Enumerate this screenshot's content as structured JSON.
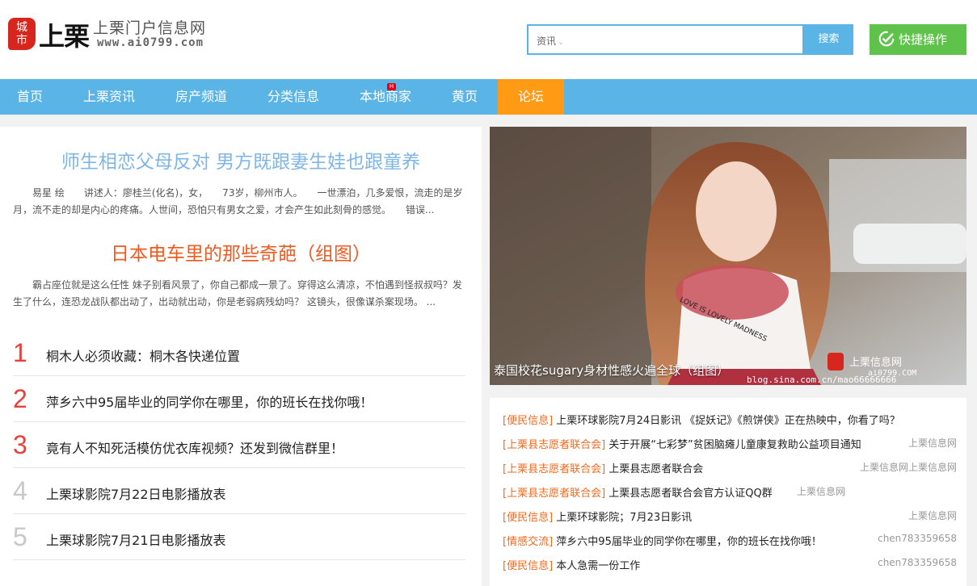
{
  "logo": {
    "badge": "城\n市",
    "main": "上栗",
    "site_name": "上栗门户信息网",
    "url": "www.ai0799.com"
  },
  "search": {
    "type": "资讯",
    "placeholder": "",
    "button": "搜索"
  },
  "quick_action": {
    "label": "快捷操作",
    "icon": "edit-check-icon"
  },
  "nav": {
    "items": [
      {
        "label": "首页"
      },
      {
        "label": "上栗资讯"
      },
      {
        "label": "房产频道"
      },
      {
        "label": "分类信息"
      },
      {
        "label": "本地商家",
        "badge": "H"
      },
      {
        "label": "黄页"
      },
      {
        "label": "论坛"
      }
    ]
  },
  "left": {
    "headline1": "师生相恋父母反对 男方既跟妻生娃也跟童养",
    "summary1": "易星 绘　　讲述人：廖桂兰(化名)，女，　　73岁，柳州市人。　　一世漂泊，几多爱恨，流走的是岁月，流不走的却是内心的疼痛。人世间，恐怕只有男女之爱，才会产生如此刻骨的感觉。　　错误...",
    "headline2": "日本电车里的那些奇葩（组图）",
    "summary2": "霸占座位就是这么任性 妹子别看风景了，你自己都成一景了。穿得这么清凉，不怕遇到怪叔叔吗？发生了什么，连恐龙战队都出动了，出动就出动，你是老弱病残幼吗？ 这镜头，很像谋杀案现场。 ...",
    "ranklist": [
      {
        "num": "1",
        "title": "桐木人必须收藏：桐木各快递位置"
      },
      {
        "num": "2",
        "title": "萍乡六中95届毕业的同学你在哪里，你的班长在找你哦！"
      },
      {
        "num": "3",
        "title": "竟有人不知死活模仿优衣库视频？还发到微信群里！"
      },
      {
        "num": "4",
        "title": "上栗球影院7月22日电影播放表"
      },
      {
        "num": "5",
        "title": "上栗球影院7月21日电影播放表"
      }
    ]
  },
  "photo": {
    "caption": "泰国校花sugary身材性感火遍全球（组图）",
    "watermark_brand": "上栗信息网",
    "watermark_url": "ai0799.COM",
    "watermark_blog": "blog.sina.com.cn/mao66666666",
    "shirt_text": "LOVE IS LOVELY MADNESS"
  },
  "news": [
    {
      "cat": "[便民信息]",
      "title": "上栗环球影院7月24日影讯 《捉妖记》《煎饼侠》正在热映中，你看了吗？",
      "src": ""
    },
    {
      "cat": "[上栗县志愿者联合会]",
      "title": "关于开展“七彩梦”贫困脑瘫儿童康复救助公益项目通知",
      "src": "上栗信息网"
    },
    {
      "cat": "[上栗县志愿者联合会]",
      "title": "上栗县志愿者联合会",
      "src": "上栗信息网上栗信息网"
    },
    {
      "cat": "[上栗县志愿者联合会]",
      "title": "上栗县志愿者联合会官方认证QQ群",
      "src": "上栗信息网"
    },
    {
      "cat": "[便民信息]",
      "title": "上栗环球影院；7月23日影讯",
      "src": "上栗信息网"
    },
    {
      "cat": "[情感交流]",
      "title": "萍乡六中95届毕业的同学你在哪里，你的班长在找你哦！",
      "src": "chen783359658"
    },
    {
      "cat": "[便民信息]",
      "title": "本人急需一份工作",
      "src": "chen783359658"
    }
  ],
  "colors": {
    "nav_bg": "#5ab4e6",
    "nav_active": "#ff9a14",
    "quick_btn": "#5fc24a",
    "headline1": "#7fb6e6",
    "headline2": "#ef5a1f",
    "rank_top": "#e8413c",
    "category": "#ef6a1f"
  }
}
